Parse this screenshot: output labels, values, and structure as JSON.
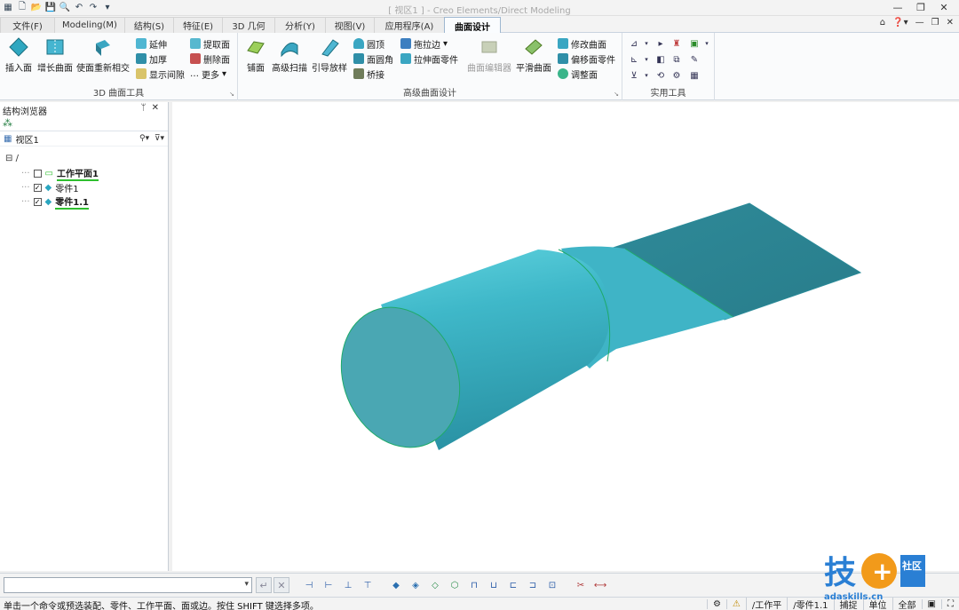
{
  "app": {
    "window_title": "[ 视区1 ] - Creo Elements/Direct Modeling"
  },
  "qat": {
    "icons": [
      "app-menu-icon",
      "new-icon",
      "open-icon",
      "save-icon",
      "print-preview-icon",
      "undo-icon",
      "redo-icon",
      "customize-icon"
    ]
  },
  "tabs": [
    {
      "label": "文件(F)"
    },
    {
      "label": "Modeling(M)"
    },
    {
      "label": "结构(S)"
    },
    {
      "label": "特征(E)"
    },
    {
      "label": "3D 几何"
    },
    {
      "label": "分析(Y)"
    },
    {
      "label": "视图(V)"
    },
    {
      "label": "应用程序(A)"
    },
    {
      "label": "曲面设计"
    }
  ],
  "ribbon": {
    "group1": {
      "label": "3D 曲面工具",
      "insert_face": "插入面",
      "grow_surface": "增长曲面",
      "reintersect": "使面重新相交",
      "extend": "延伸",
      "thicken": "加厚",
      "show_gap": "显示间隙",
      "extract_face": "提取面",
      "delete_face": "删除面",
      "more": "更多"
    },
    "group2": {
      "label": "高级曲面设计",
      "patch": "铺面",
      "adv_sweep": "高级扫描",
      "guided_loft": "引导放样",
      "dome": "圆顶",
      "face_fillet": "面圆角",
      "bridge": "桥接",
      "drag_edge": "拖拉边",
      "stretch_part": "拉伸面零件",
      "surface_editor": "曲面编辑器",
      "smooth_surface": "平滑曲面",
      "modify_surface": "修改曲面",
      "offset_part": "偏移面零件",
      "adjust_face": "调整面"
    },
    "group3": {
      "label": "实用工具"
    }
  },
  "sidebar": {
    "title": "结构浏览器",
    "pin": "ᛘ",
    "close": "✕",
    "view_label": "视区1",
    "tree": [
      {
        "label": "工作平面1",
        "checked": false
      },
      {
        "label": "零件1",
        "checked": true
      },
      {
        "label": "零件1.1",
        "checked": true
      }
    ]
  },
  "bottom": {
    "cmd_placeholder": "",
    "enter": "↵",
    "cancel": "✕"
  },
  "status": {
    "message": "单击一个命令或预选装配、零件、工作平面、面或边。按住 SHIFT 键选择多项。",
    "workplane": "/工作平",
    "part": "/零件1.1",
    "snap": "捕捉",
    "unit": "单位",
    "all": "全部"
  },
  "watermark": {
    "brand": "技",
    "sub": "社区",
    "url": "adaskills.cn"
  },
  "colors": {
    "model_body": "#3fb8c9",
    "model_flat": "#2b8796",
    "model_face_end": "#4aa7b3",
    "edge": "#1faa6a",
    "highlight": "#2fbf2f"
  }
}
